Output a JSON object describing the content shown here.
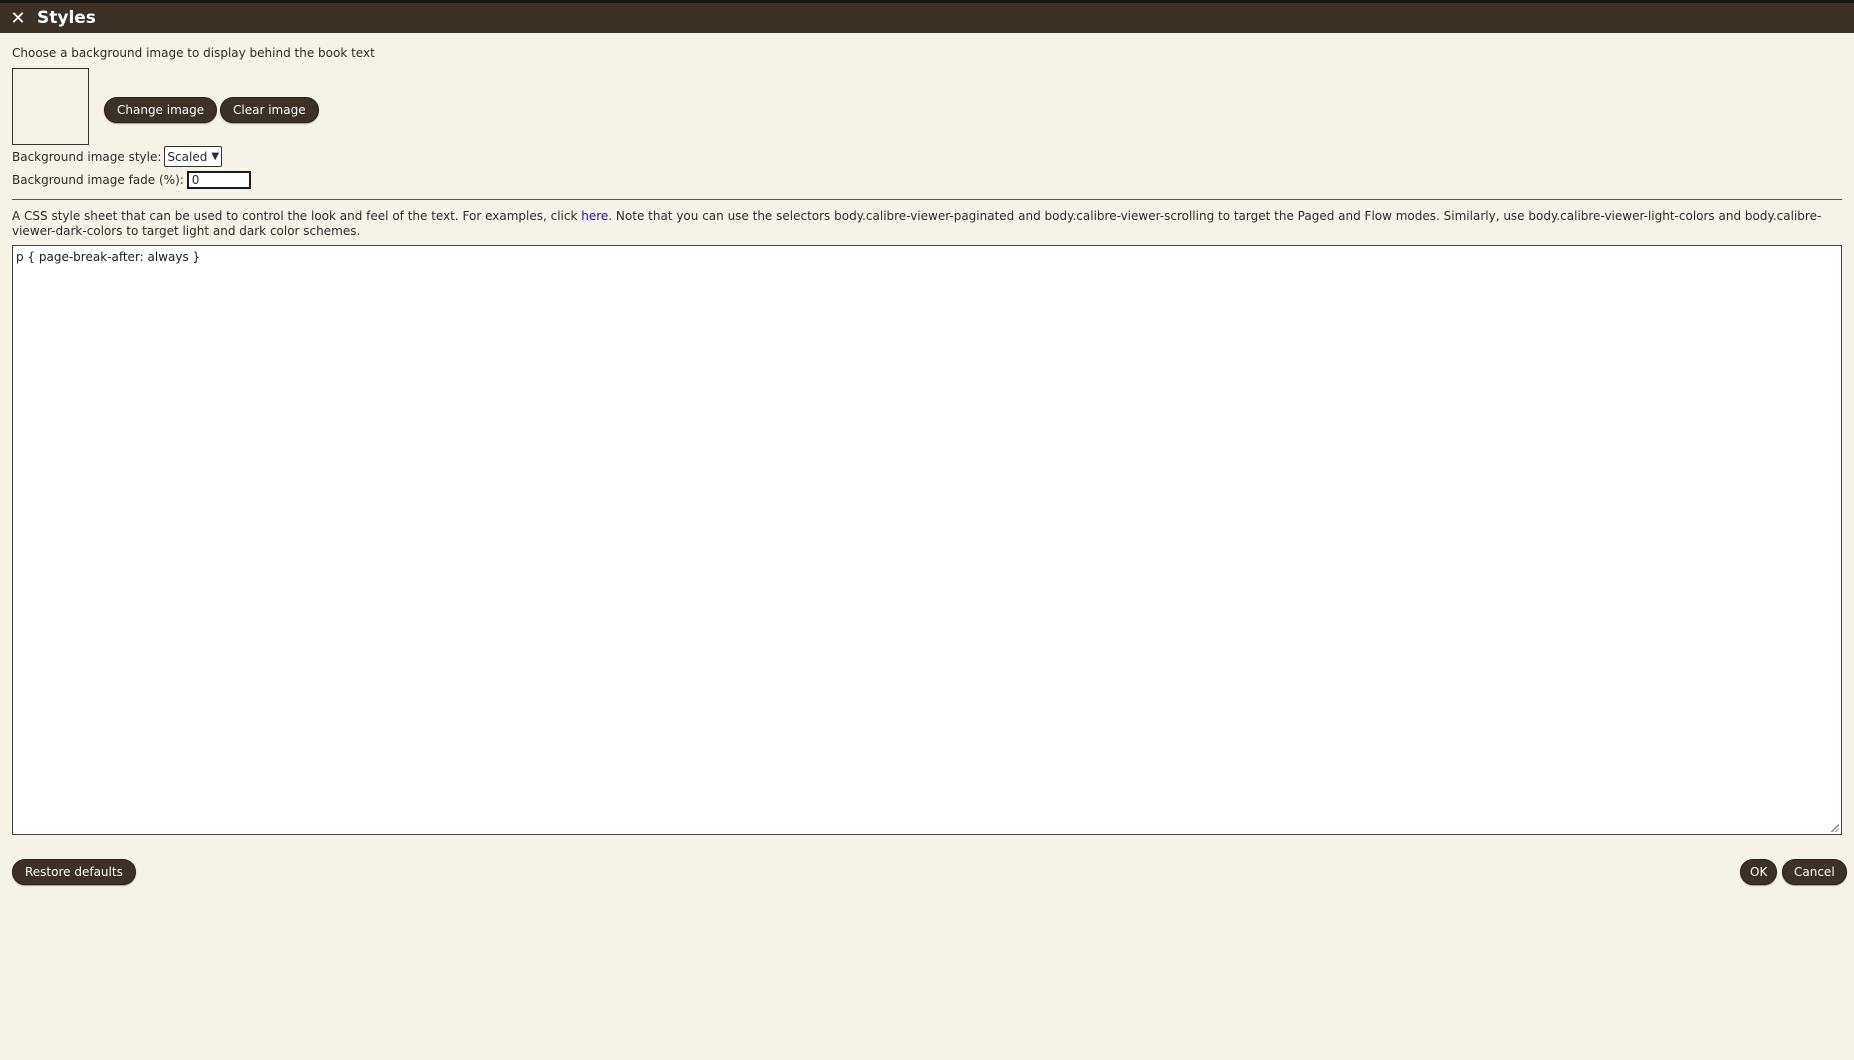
{
  "dialog": {
    "title": "Styles"
  },
  "background": {
    "intro": "Choose a background image to display behind the book text",
    "change_image": "Change image",
    "clear_image": "Clear image",
    "style_label": "Background image style:",
    "style_value": "Scaled",
    "fade_label": "Background image fade (%):",
    "fade_value": "0"
  },
  "css": {
    "desc_before": "A CSS style sheet that can be used to control the look and feel of the text. For examples, click ",
    "link_text": "here",
    "desc_after": ". Note that you can use the selectors body.calibre-viewer-paginated and body.calibre-viewer-scrolling to target the Paged and Flow modes. Similarly, use body.calibre-viewer-light-colors and body.calibre-viewer-dark-colors to target light and dark color schemes.",
    "content": "p { page-break-after: always }"
  },
  "footer": {
    "restore_defaults": "Restore defaults",
    "ok": "OK",
    "cancel": "Cancel"
  },
  "colors": {
    "titlebar": "#3b3127",
    "background": "#f5f2e7",
    "button": "#3b3127",
    "link": "#1a0dab"
  }
}
